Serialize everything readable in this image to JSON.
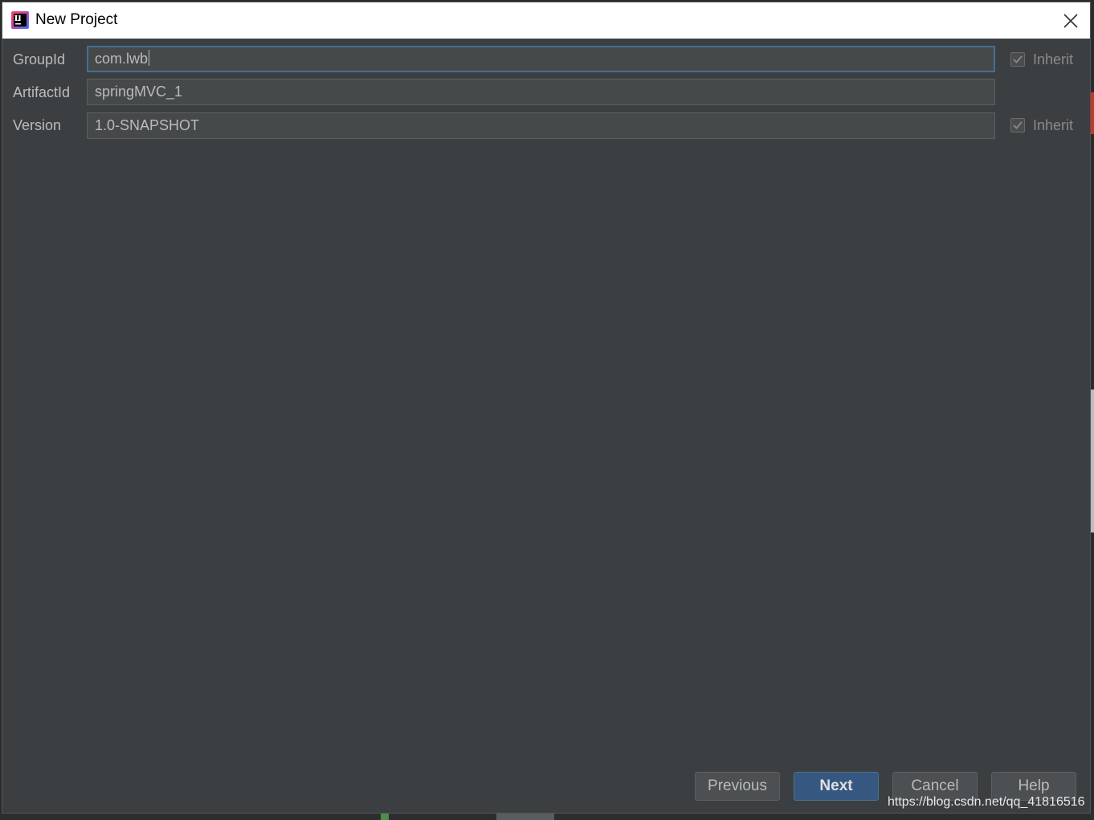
{
  "window": {
    "title": "New Project"
  },
  "form": {
    "group_id": {
      "label": "GroupId",
      "value": "com.lwb"
    },
    "artifact_id": {
      "label": "ArtifactId",
      "value": "springMVC_1"
    },
    "version": {
      "label": "Version",
      "value": "1.0-SNAPSHOT"
    },
    "inherit_group": {
      "label": "Inherit",
      "checked": true
    },
    "inherit_version": {
      "label": "Inherit",
      "checked": true
    }
  },
  "buttons": {
    "previous": "Previous",
    "next": "Next",
    "cancel": "Cancel",
    "help": "Help"
  },
  "watermark": "https://blog.csdn.net/qq_41816516",
  "colors": {
    "dialog_bg": "#3c3f41",
    "field_bg": "#45494a",
    "focus_border": "#466d94",
    "primary_button": "#365880"
  },
  "icons": {
    "app": "intellij-idea-icon",
    "close": "close-icon",
    "check": "checkmark-icon"
  }
}
